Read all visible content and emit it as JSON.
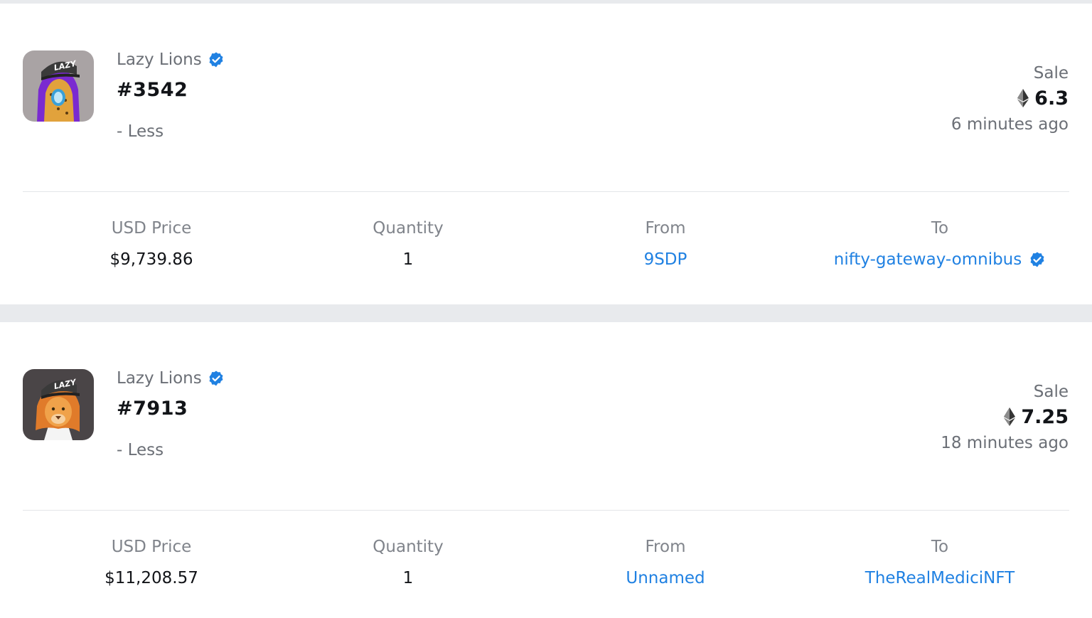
{
  "events": [
    {
      "collection": "Lazy Lions",
      "token_id": "#3542",
      "toggle_label": "- Less",
      "event_type": "Sale",
      "price_eth": "6.3",
      "time_ago": "6 minutes ago",
      "details": {
        "usd_label": "USD Price",
        "usd_value": "$9,739.86",
        "qty_label": "Quantity",
        "qty_value": "1",
        "from_label": "From",
        "from_value": "9SDP",
        "to_label": "To",
        "to_value": "nifty-gateway-omnibus",
        "to_verified": true
      },
      "thumb_hat_text": "LAZY",
      "thumb_colors": {
        "bg": "#a9a3a4",
        "mane": "#7a2ad0",
        "face": "#e1a23c"
      }
    },
    {
      "collection": "Lazy Lions",
      "token_id": "#7913",
      "toggle_label": "- Less",
      "event_type": "Sale",
      "price_eth": "7.25",
      "time_ago": "18 minutes ago",
      "details": {
        "usd_label": "USD Price",
        "usd_value": "$11,208.57",
        "qty_label": "Quantity",
        "qty_value": "1",
        "from_label": "From",
        "from_value": "Unnamed",
        "to_label": "To",
        "to_value": "TheRealMediciNFT",
        "to_verified": false
      },
      "thumb_hat_text": "LAZY",
      "thumb_colors": {
        "bg": "#4a4547",
        "mane": "#e07b2a",
        "face": "#f0a24a"
      }
    }
  ],
  "colors": {
    "accent": "#2081e2",
    "text_primary": "#121418",
    "text_secondary": "#6b6f76",
    "separator": "#e8eaed"
  },
  "icons": {
    "verified": "verified-badge-icon",
    "currency": "ethereum-icon"
  }
}
